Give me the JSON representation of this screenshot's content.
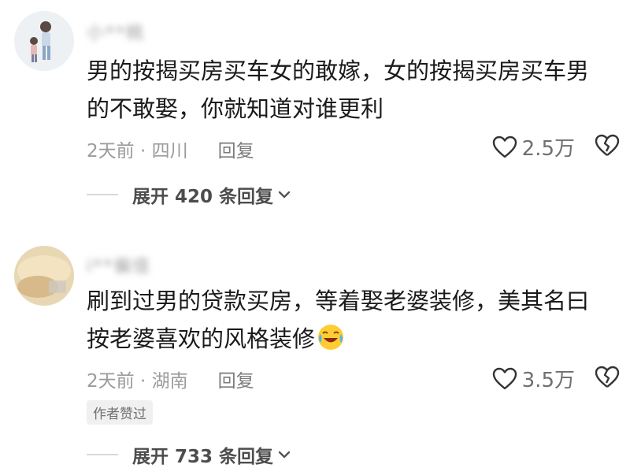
{
  "comments": [
    {
      "username": "小**桃",
      "text_line1": "男的按揭买房买车女的敢嫁，女的按揭买房买车男",
      "text_line2": "的不敢娶，你就知道对谁更利",
      "time_location": "2天前 · 四川",
      "reply_label": "回复",
      "likes": "2.5万",
      "expand_label": "展开 420 条回复"
    },
    {
      "username": "ⅰ**偏佳",
      "text_line1": "刷到过男的贷款买房，等着娶老婆装修，美其名曰",
      "text_line2": "按老婆喜欢的风格装修",
      "time_location": "2天前 · 湖南",
      "reply_label": "回复",
      "likes": "3.5万",
      "author_badge": "作者赞过",
      "expand_label": "展开 733 条回复"
    }
  ],
  "icons": {
    "like": "heart-outline-icon",
    "dislike": "broken-heart-icon",
    "expand": "chevron-down-icon",
    "emoji": "laughing-crying-emoji"
  }
}
